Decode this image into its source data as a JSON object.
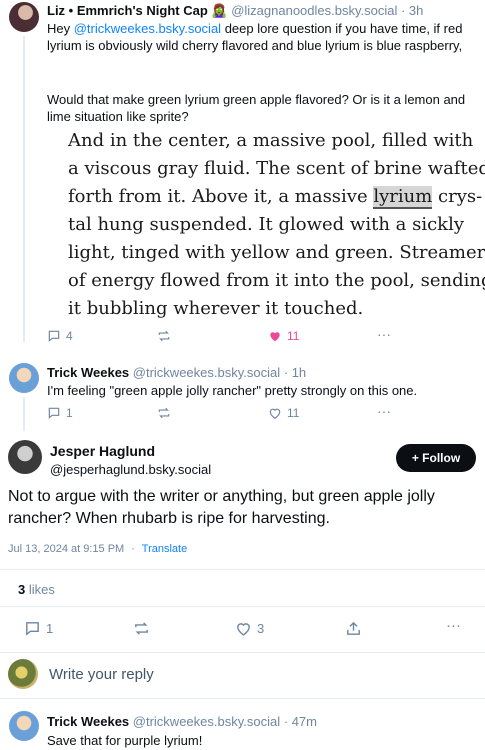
{
  "post1": {
    "display_name": "Liz • Emmrich's Night Cap 🧟‍♀️",
    "handle": "@lizagnanoodles.bsky.social",
    "time": "· 3h",
    "text_before": "Hey ",
    "mention": "@trickweekes.bsky.social",
    "text_after": " deep lore question if you have time, if red lyrium is obviously wild cherry flavored and blue lyrium is blue raspberry,",
    "text_2": "Would that make green lyrium green apple flavored? Or is it a lemon and lime situation like sprite?",
    "image_quote": {
      "line1": "And in the center, a massive pool, filled with",
      "line2": "a viscous gray fluid. The scent of brine wafted",
      "line3_a": "forth from it. Above it, a massive ",
      "line3_hl": "lyrium",
      "line3_b": " crys-",
      "line4": "tal hung suspended. It glowed with a sickly",
      "line5": "light, tinged with yellow and green. Streamers",
      "line6": "of energy flowed from it into the pool, sending",
      "line7": "it bubbling wherever it touched."
    },
    "reply_count": "4",
    "like_count": "11",
    "more": "···"
  },
  "post2": {
    "display_name": "Trick Weekes",
    "handle": "@trickweekes.bsky.social",
    "time": "· 1h",
    "text": "I'm feeling \"green apple jolly rancher\" pretty strongly on this one.",
    "reply_count": "1",
    "like_count": "11",
    "more": "···"
  },
  "main_post": {
    "display_name": "Jesper Haglund",
    "handle": "@jesperhaglund.bsky.social",
    "follow_label": "+ Follow",
    "text": "Not to argue with the writer or anything, but green apple jolly rancher? When rhubarb is ripe for harvesting.",
    "timestamp": "Jul 13, 2024 at 9:15 PM",
    "sep": "·",
    "translate": "Translate",
    "likes_count": "3",
    "likes_label": "likes",
    "reply_count": "1",
    "like_count": "3",
    "more": "···"
  },
  "composer": {
    "placeholder": "Write your reply"
  },
  "post3": {
    "display_name": "Trick Weekes",
    "handle": "@trickweekes.bsky.social",
    "time": "· 47m",
    "text": "Save that for purple lyrium!"
  },
  "colors": {
    "accent": "#1083fe",
    "like_pink": "#ec4899",
    "muted": "#6f869f",
    "divider": "#e6ecf1"
  }
}
